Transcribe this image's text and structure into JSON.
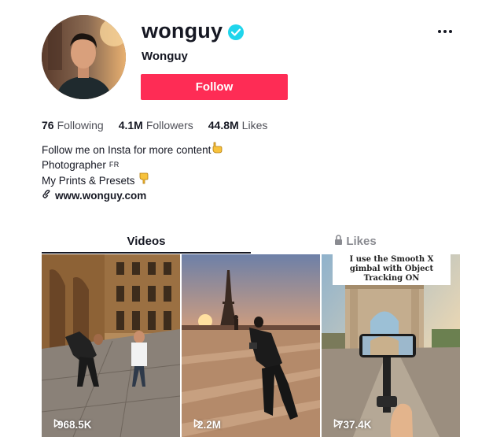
{
  "profile": {
    "username": "wonguy",
    "nickname": "Wonguy",
    "verified": true,
    "follow_label": "Follow",
    "accent": "#fe2c55",
    "verified_color": "#20d5ec"
  },
  "stats": [
    {
      "value": "76",
      "label": "Following"
    },
    {
      "value": "4.1M",
      "label": "Followers"
    },
    {
      "value": "44.8M",
      "label": "Likes"
    }
  ],
  "bio": {
    "line1": "Follow me on Insta for more content",
    "line2": "Photographer",
    "line2_flag": "FR",
    "line3": "My Prints & Presets",
    "link": "www.wonguy.com"
  },
  "tabs": {
    "videos": "Videos",
    "likes": "Likes"
  },
  "videos": [
    {
      "views": "968.5K",
      "caption": ""
    },
    {
      "views": "2.2M",
      "caption": ""
    },
    {
      "views": "737.4K",
      "caption": "I use the Smooth X gimbal with Object Tracking ON"
    }
  ]
}
